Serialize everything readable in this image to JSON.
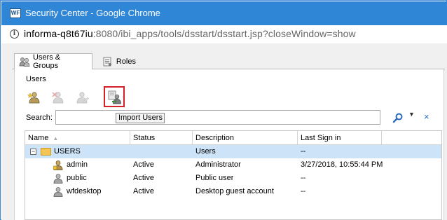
{
  "window": {
    "title": "Security Center - Google Chrome",
    "app_icon_text": "WF"
  },
  "address": {
    "host": "informa-q8t67iu",
    "path": ":8080/ibi_apps/tools/dsstart/dsstart.jsp?closeWindow=show"
  },
  "tabs": [
    {
      "label": "Users & Groups",
      "active": true
    },
    {
      "label": "Roles",
      "active": false
    }
  ],
  "panel": {
    "section_label": "Users",
    "toolbar": {
      "tooltip": "Import Users"
    },
    "search": {
      "label": "Search:",
      "value": "",
      "clear_glyph": "×",
      "dropdown_glyph": "▼"
    },
    "grid": {
      "columns": [
        "Name",
        "Status",
        "Description",
        "Last Sign in"
      ],
      "rows": [
        {
          "name": "USERS",
          "status": "",
          "description": "Users",
          "last_sign_in": "--",
          "type": "folder"
        },
        {
          "name": "admin",
          "status": "Active",
          "description": "Administrator",
          "last_sign_in": "3/27/2018, 10:55:44 PM",
          "type": "admin"
        },
        {
          "name": "public",
          "status": "Active",
          "description": "Public user",
          "last_sign_in": "--",
          "type": "user"
        },
        {
          "name": "wfdesktop",
          "status": "Active",
          "description": "Desktop guest account",
          "last_sign_in": "--",
          "type": "user"
        }
      ]
    }
  },
  "colors": {
    "titlebar": "#2f86d6",
    "selection": "#cde3f7",
    "highlight_box": "#d32029"
  }
}
